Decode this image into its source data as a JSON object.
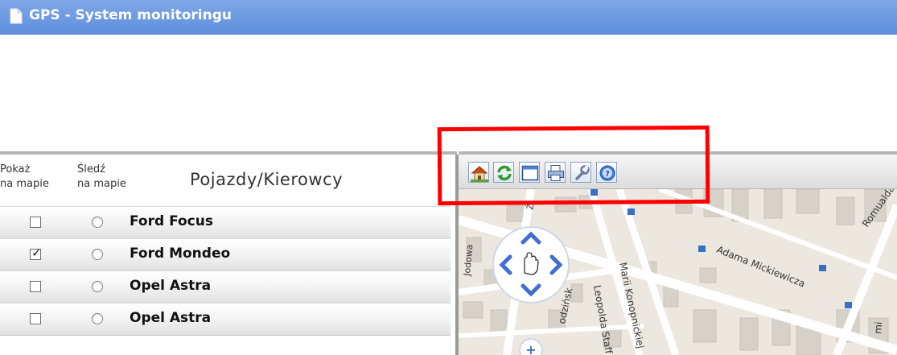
{
  "window": {
    "title": "GPS - System monitoringu"
  },
  "vehicle_table": {
    "header": {
      "show_on_map": "Pokaż\nna mapie",
      "track_on_map": "Śledź\nna mapie",
      "title": "Pojazdy/Kierowcy"
    },
    "rows": [
      {
        "name": "Ford Focus",
        "shown": false,
        "tracked": false
      },
      {
        "name": "Ford Mondeo",
        "shown": true,
        "tracked": false
      },
      {
        "name": "Opel Astra",
        "shown": false,
        "tracked": false
      },
      {
        "name": "Opel Astra",
        "shown": false,
        "tracked": false
      }
    ]
  },
  "map_toolbar": {
    "buttons": [
      "home-icon",
      "refresh-icon",
      "window-icon",
      "print-icon",
      "settings-icon",
      "help-icon"
    ]
  },
  "map": {
    "street_labels": {
      "adama": "Adama Mickiewicza",
      "maria": "Marii Konopnickiej",
      "leopolda": "Leopolda Staff",
      "romualda": "Romualda",
      "zielinski": "odzińsk",
      "left": "Jodowa",
      "top": "Ż",
      "rmi": "mi"
    },
    "pan_control": "pan-hand-icon",
    "zoom_in": "+"
  },
  "colors": {
    "title_bar": "#6b96df",
    "highlight": "#ff0000"
  }
}
